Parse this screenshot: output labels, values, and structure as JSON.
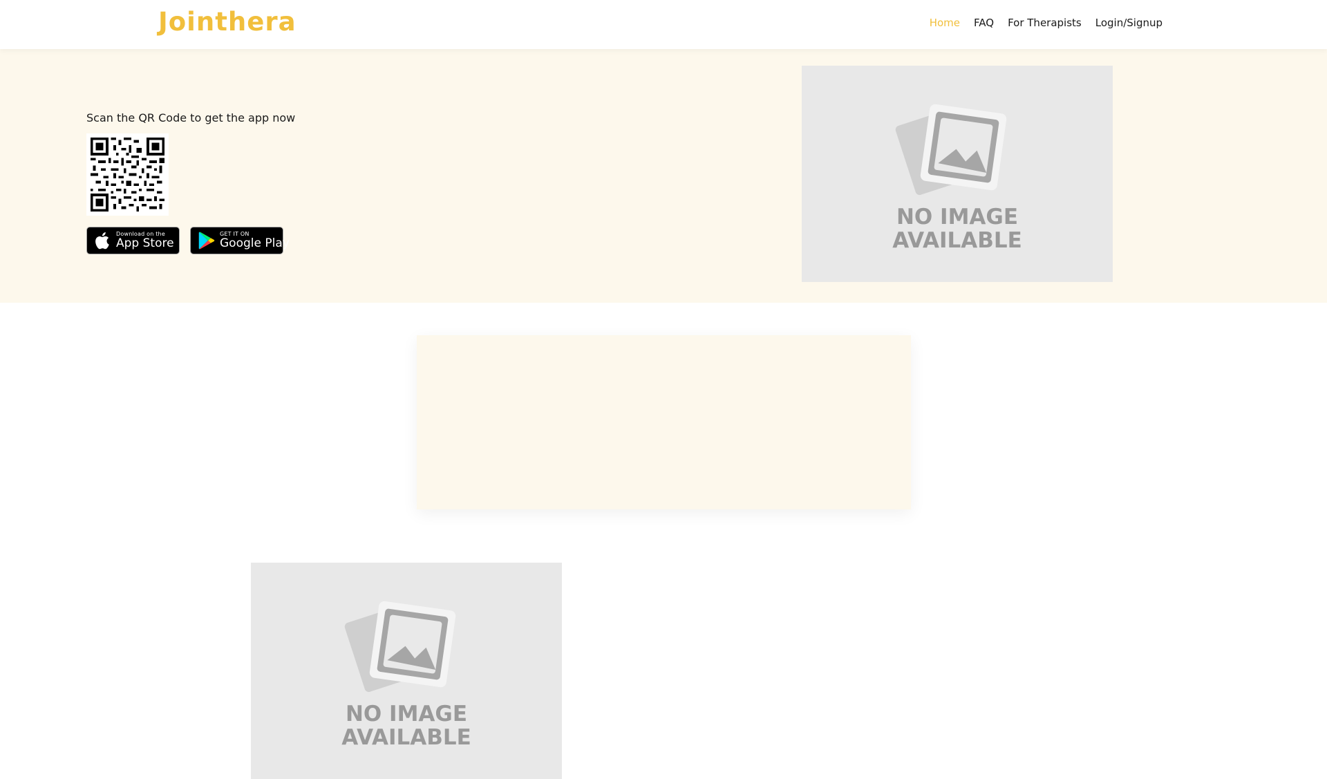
{
  "header": {
    "logo_text": "Jointhera",
    "nav": [
      {
        "label": "Home",
        "active": true
      },
      {
        "label": "FAQ",
        "active": false
      },
      {
        "label": "For Therapists",
        "active": false
      },
      {
        "label": "Login/Signup",
        "active": false
      }
    ]
  },
  "hero": {
    "qr_caption": "Scan the QR Code to get the app now",
    "app_store": {
      "small": "Download on the",
      "large": "App Store",
      "icon": "apple-icon"
    },
    "google_play": {
      "small": "GET IT ON",
      "large": "Google Play",
      "icon": "google-play-icon"
    },
    "image_placeholder": {
      "line1": "NO IMAGE",
      "line2": "AVAILABLE"
    }
  },
  "lower": {
    "image_placeholder": {
      "line1": "NO IMAGE",
      "line2": "AVAILABLE"
    }
  },
  "colors": {
    "accent": "#f1bf3c",
    "hero_background": "#fdf8ec",
    "placeholder_background": "#e8e8e8",
    "placeholder_text": "#999999"
  }
}
